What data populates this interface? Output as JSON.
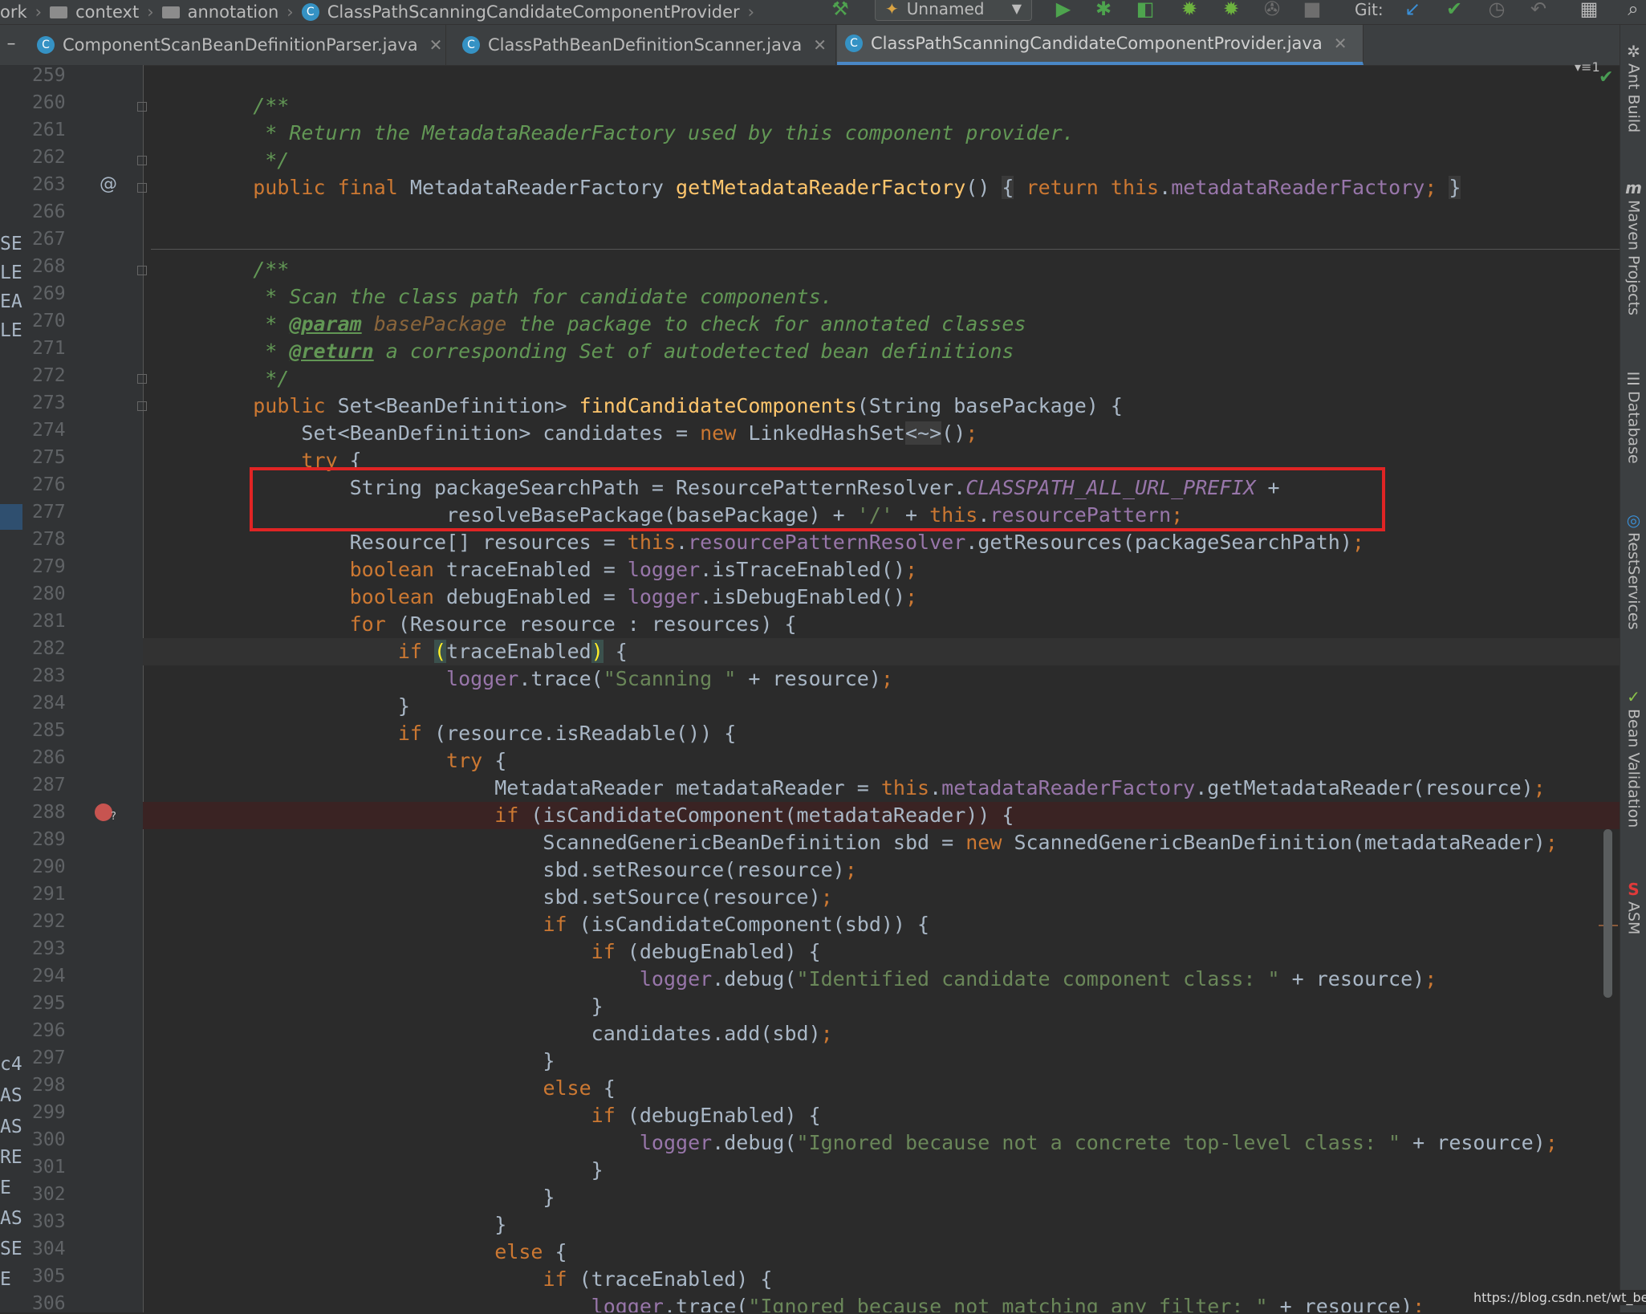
{
  "breadcrumb": {
    "items": [
      "ork",
      "context",
      "annotation",
      "ClassPathScanningCandidateComponentProvider"
    ]
  },
  "toolbar": {
    "run_config": "Unnamed",
    "git_label": "Git:"
  },
  "tabs": [
    {
      "label": "ComponentScanBeanDefinitionParser.java",
      "active": false
    },
    {
      "label": "ClassPathBeanDefinitionScanner.java",
      "active": false
    },
    {
      "label": "ClassPathScanningCandidateComponentProvider.java",
      "active": true
    }
  ],
  "tab_menu_count": "1",
  "gutter": {
    "line_numbers": [
      "259",
      "260",
      "261",
      "262",
      "263",
      "266",
      "267",
      "268",
      "269",
      "270",
      "271",
      "272",
      "273",
      "274",
      "275",
      "276",
      "277",
      "278",
      "279",
      "280",
      "281",
      "282",
      "283",
      "284",
      "285",
      "286",
      "287",
      "288",
      "289",
      "290",
      "291",
      "292",
      "293",
      "294",
      "295",
      "296",
      "297",
      "298",
      "299",
      "300",
      "301",
      "302",
      "303",
      "304",
      "305",
      "306"
    ],
    "override_marker": "@",
    "breakpoint_marker": "?"
  },
  "left_strip_texts": [
    "SE",
    "LE",
    "EA",
    "LE",
    "c4.",
    "ASI",
    "ASI",
    "RE",
    "E",
    "ASE",
    "SE",
    "E"
  ],
  "right_tools": [
    {
      "label": "Ant Build",
      "icon": "ant-icon"
    },
    {
      "label": "Maven Projects",
      "icon": "maven-icon"
    },
    {
      "label": "Database",
      "icon": "database-icon"
    },
    {
      "label": "RestServices",
      "icon": "rest-services-icon"
    },
    {
      "label": "Bean Validation",
      "icon": "bean-validation-icon"
    },
    {
      "label": "ASM",
      "icon": "asm-icon"
    }
  ],
  "watermark": "https://blog.csdn.net/wt_better",
  "colors": {
    "editor_bg": "#2b2b2b",
    "keyword": "#cc7832",
    "comment": "#629755",
    "string": "#6a8759",
    "field": "#9876aa",
    "method": "#ffc66d",
    "highlight_box": "#e02424",
    "breakpoint": "#c75450"
  }
}
